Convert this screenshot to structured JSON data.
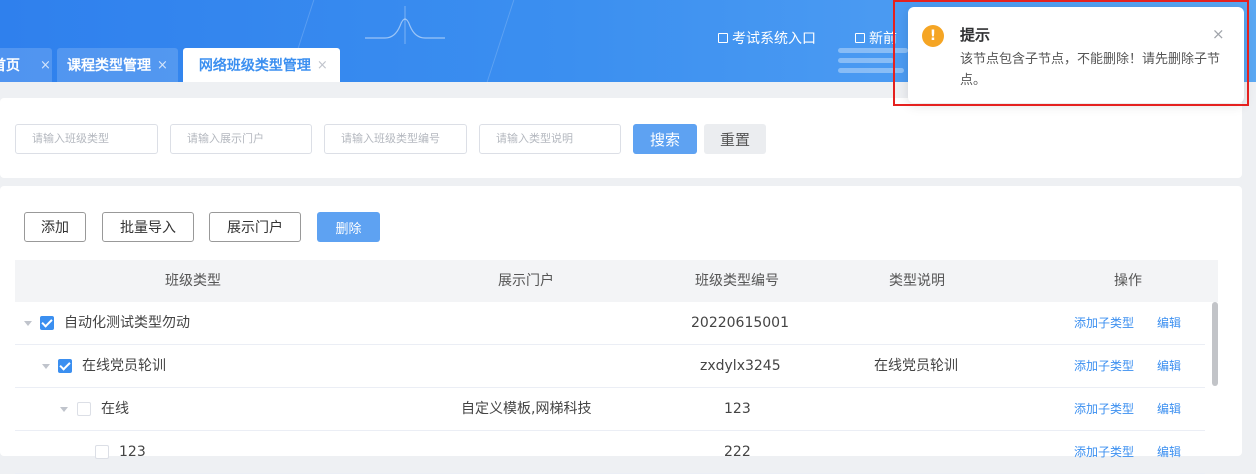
{
  "header": {
    "links": [
      {
        "label": "考试系统入口",
        "icon": "edit-icon"
      },
      {
        "label": "新前",
        "icon": "share-icon"
      }
    ]
  },
  "tabs": [
    {
      "label": "首页",
      "active": false
    },
    {
      "label": "课程类型管理",
      "active": false
    },
    {
      "label": "网络班级类型管理",
      "active": true
    }
  ],
  "tab_close": "×",
  "search": {
    "fields": [
      {
        "placeholder": "请输入班级类型"
      },
      {
        "placeholder": "请输入展示门户"
      },
      {
        "placeholder": "请输入班级类型编号"
      },
      {
        "placeholder": "请输入类型说明"
      }
    ],
    "search_label": "搜索",
    "reset_label": "重置"
  },
  "toolbar": {
    "add": "添加",
    "import": "批量导入",
    "portal": "展示门户",
    "delete": "删除"
  },
  "table": {
    "columns": [
      "班级类型",
      "展示门户",
      "班级类型编号",
      "类型说明",
      "操作"
    ],
    "rows": [
      {
        "name": "自动化测试类型勿动",
        "portal": "",
        "code": "20220615001",
        "desc": "",
        "checked": true,
        "level": 0
      },
      {
        "name": "在线党员轮训",
        "portal": "",
        "code": "zxdylx3245",
        "desc": "在线党员轮训",
        "checked": true,
        "level": 1
      },
      {
        "name": "在线",
        "portal": "自定义模板,网梯科技",
        "code": "123",
        "desc": "",
        "checked": false,
        "level": 2
      },
      {
        "name": "123",
        "portal": "",
        "code": "222",
        "desc": "",
        "checked": false,
        "level": 3
      }
    ],
    "actions": {
      "add_child": "添加子类型",
      "edit": "编辑"
    }
  },
  "notification": {
    "title": "提示",
    "message": "该节点包含子节点，不能删除！请先删除子节点。",
    "icon": "warning-icon",
    "close": "×"
  },
  "colors": {
    "primary": "#3b8ff0",
    "warning": "#f5a524",
    "highlight": "#e5211f"
  }
}
